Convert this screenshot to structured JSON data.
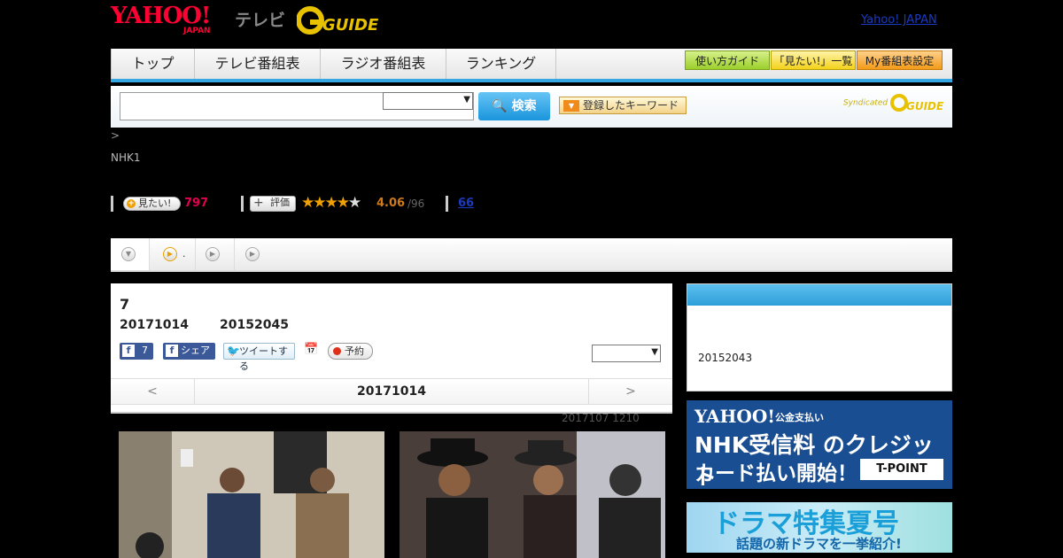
{
  "header": {
    "yahoo_logo": "YAHOO!",
    "yahoo_japan": "JAPAN",
    "tv_label": "テレビ",
    "gguide_logo": "GUIDE",
    "yahoo_japan_link": "Yahoo! JAPAN"
  },
  "nav": {
    "items": [
      "トップ",
      "テレビ番組表",
      "ラジオ番組表",
      "ランキング"
    ],
    "guide_buttons": [
      "使い方ガイド",
      "「見たい!」一覧",
      "My番組表設定"
    ]
  },
  "search": {
    "button_label": "検索",
    "keyword_button": "登録したキーワード",
    "syndicated": "Syndicated"
  },
  "program": {
    "breadcrumb": ">",
    "channel": "NHK1",
    "mitai_label": "見たい!",
    "mitai_count": "797",
    "rating_label": "評価",
    "rating_stars": 4.06,
    "rating_value": "4.06",
    "rating_count": "/96",
    "review_count": "66",
    "tabs": [
      "",
      "."
    ],
    "episode_title": "7",
    "air_date": "20171014",
    "program_code": "20152045",
    "fb_count": "7",
    "fb_share": "シェア",
    "tweet": "ツイートする",
    "reserve": "予約",
    "pager_prev": "<",
    "pager_date": "20171014",
    "pager_next": ">",
    "footnote": "2017107  1210"
  },
  "sidebar": {
    "code": "20152043"
  },
  "ads": {
    "ad1_yahoo": "YAHOO!",
    "ad1_koukin": "公金支払い",
    "ad1_line1": "NHK受信料 のクレジット",
    "ad1_line2": "カード払い開始！",
    "ad1_tpoint": "T-POINT",
    "ad2_line1": "ドラマ特集夏号",
    "ad2_line2": "話題の新ドラマを一挙紹介!"
  },
  "colors": {
    "accent_blue": "#35a7e3",
    "yahoo_red": "#ff0033",
    "count_pink": "#e5004f",
    "link_blue": "#1a3bbf"
  }
}
